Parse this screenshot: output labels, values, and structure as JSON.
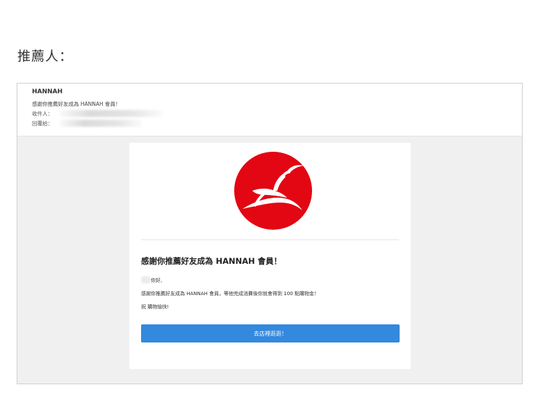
{
  "page": {
    "heading": "推薦人："
  },
  "email": {
    "sender": "HANNAH",
    "subject": "感謝你推薦好友成為 HANNAH 會員！",
    "to_label": "收件人：",
    "reply_label": "回覆給："
  },
  "card": {
    "logo_icon": "gazelle-logo-icon",
    "brand_color": "#e30613",
    "title": "感謝你推薦好友成為 HANNAH 會員！",
    "greeting": "你好,",
    "body": "感謝你推薦好友成為 HANNAH 會員，等他完成消費後你就會得到 100 點購物金！",
    "closing": "祝 購物愉快!",
    "cta_label": "去店裡逛逛！",
    "cta_color": "#3389dd"
  }
}
